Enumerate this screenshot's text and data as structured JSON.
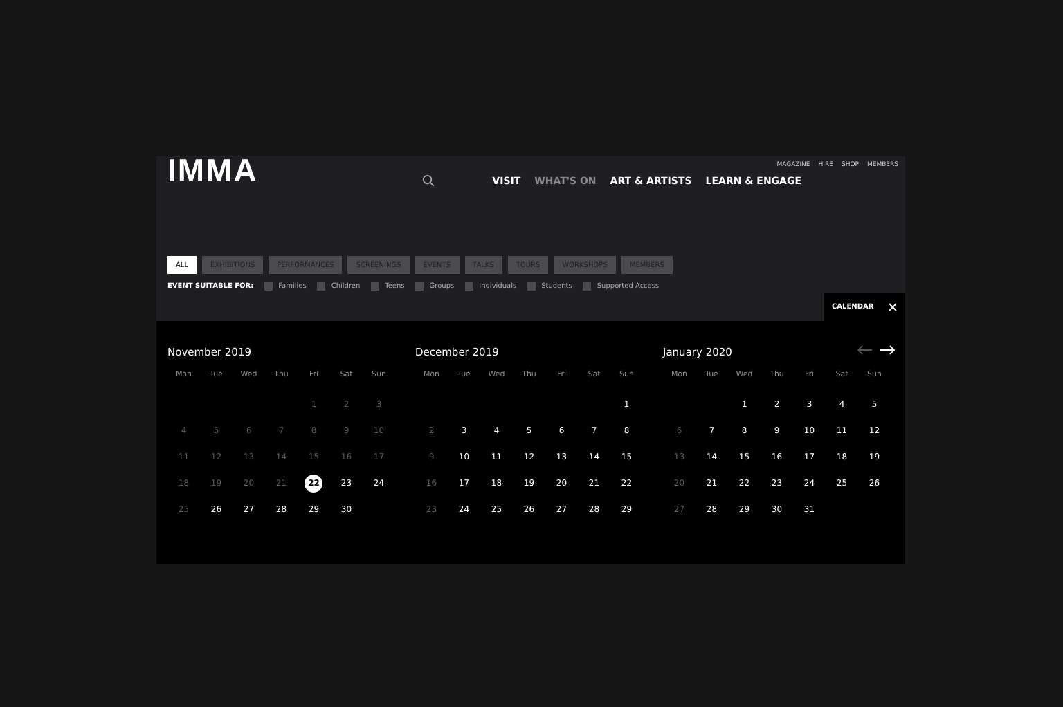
{
  "header": {
    "logo": "IMMA",
    "utility_links": [
      "MAGAZINE",
      "HIRE",
      "SHOP",
      "MEMBERS"
    ],
    "nav": [
      {
        "label": "VISIT",
        "selected": false
      },
      {
        "label": "WHAT'S ON",
        "selected": true
      },
      {
        "label": "ART & ARTISTS",
        "selected": false
      },
      {
        "label": "LEARN & ENGAGE",
        "selected": false
      }
    ]
  },
  "categories": [
    {
      "label": "ALL",
      "selected": true
    },
    {
      "label": "EXHIBITIONS",
      "selected": false
    },
    {
      "label": "PERFORMANCES",
      "selected": false
    },
    {
      "label": "SCREENINGS",
      "selected": false
    },
    {
      "label": "EVENTS",
      "selected": false
    },
    {
      "label": "TALKS",
      "selected": false
    },
    {
      "label": "TOURS",
      "selected": false
    },
    {
      "label": "WORKSHOPS",
      "selected": false
    },
    {
      "label": "MEMBERS",
      "selected": false
    }
  ],
  "audience": {
    "label": "EVENT SUITABLE FOR:",
    "options": [
      {
        "label": "Families",
        "checked": false
      },
      {
        "label": "Children",
        "checked": false
      },
      {
        "label": "Teens",
        "checked": false
      },
      {
        "label": "Groups",
        "checked": false
      },
      {
        "label": "Individuals",
        "checked": false
      },
      {
        "label": "Students",
        "checked": false
      },
      {
        "label": "Supported Access",
        "checked": false
      }
    ]
  },
  "calendar_tab": {
    "label": "CALENDAR"
  },
  "calendar": {
    "prev_disabled": true,
    "next_disabled": false,
    "months": [
      {
        "title": "November 2019",
        "weekdays": [
          "Mon",
          "Tue",
          "Wed",
          "Thu",
          "Fri",
          "Sat",
          "Sun"
        ],
        "weeks": [
          {
            "starts_mid_week": true,
            "days": [
              {
                "label": "1",
                "muted": true,
                "selected": false
              },
              {
                "label": "2",
                "muted": true,
                "selected": false
              },
              {
                "label": "3",
                "muted": true,
                "selected": false
              }
            ]
          },
          {
            "starts_mid_week": false,
            "days": [
              {
                "label": "4",
                "muted": true,
                "selected": false
              },
              {
                "label": "5",
                "muted": true,
                "selected": false
              },
              {
                "label": "6",
                "muted": true,
                "selected": false
              },
              {
                "label": "7",
                "muted": true,
                "selected": false
              },
              {
                "label": "8",
                "muted": true,
                "selected": false
              },
              {
                "label": "9",
                "muted": true,
                "selected": false
              },
              {
                "label": "10",
                "muted": true,
                "selected": false
              }
            ]
          },
          {
            "starts_mid_week": false,
            "days": [
              {
                "label": "11",
                "muted": true,
                "selected": false
              },
              {
                "label": "12",
                "muted": true,
                "selected": false
              },
              {
                "label": "13",
                "muted": true,
                "selected": false
              },
              {
                "label": "14",
                "muted": true,
                "selected": false
              },
              {
                "label": "15",
                "muted": true,
                "selected": false
              },
              {
                "label": "16",
                "muted": true,
                "selected": false
              },
              {
                "label": "17",
                "muted": true,
                "selected": false
              }
            ]
          },
          {
            "starts_mid_week": false,
            "days": [
              {
                "label": "18",
                "muted": true,
                "selected": false
              },
              {
                "label": "19",
                "muted": true,
                "selected": false
              },
              {
                "label": "20",
                "muted": true,
                "selected": false
              },
              {
                "label": "21",
                "muted": true,
                "selected": false
              },
              {
                "label": "22",
                "muted": false,
                "selected": true
              },
              {
                "label": "23",
                "muted": false,
                "selected": false
              },
              {
                "label": "24",
                "muted": false,
                "selected": false
              }
            ]
          },
          {
            "starts_mid_week": false,
            "days": [
              {
                "label": "25",
                "muted": true,
                "selected": false
              },
              {
                "label": "26",
                "muted": false,
                "selected": false
              },
              {
                "label": "27",
                "muted": false,
                "selected": false
              },
              {
                "label": "28",
                "muted": false,
                "selected": false
              },
              {
                "label": "29",
                "muted": false,
                "selected": false
              },
              {
                "label": "30",
                "muted": false,
                "selected": false
              }
            ]
          }
        ]
      },
      {
        "title": "December 2019",
        "weekdays": [
          "Mon",
          "Tue",
          "Wed",
          "Thu",
          "Fri",
          "Sat",
          "Sun"
        ],
        "weeks": [
          {
            "starts_mid_week": true,
            "days": [
              {
                "label": "1",
                "muted": false,
                "selected": false
              }
            ]
          },
          {
            "starts_mid_week": false,
            "days": [
              {
                "label": "2",
                "muted": true,
                "selected": false
              },
              {
                "label": "3",
                "muted": false,
                "selected": false
              },
              {
                "label": "4",
                "muted": false,
                "selected": false
              },
              {
                "label": "5",
                "muted": false,
                "selected": false
              },
              {
                "label": "6",
                "muted": false,
                "selected": false
              },
              {
                "label": "7",
                "muted": false,
                "selected": false
              },
              {
                "label": "8",
                "muted": false,
                "selected": false
              }
            ]
          },
          {
            "starts_mid_week": false,
            "days": [
              {
                "label": "9",
                "muted": true,
                "selected": false
              },
              {
                "label": "10",
                "muted": false,
                "selected": false
              },
              {
                "label": "11",
                "muted": false,
                "selected": false
              },
              {
                "label": "12",
                "muted": false,
                "selected": false
              },
              {
                "label": "13",
                "muted": false,
                "selected": false
              },
              {
                "label": "14",
                "muted": false,
                "selected": false
              },
              {
                "label": "15",
                "muted": false,
                "selected": false
              }
            ]
          },
          {
            "starts_mid_week": false,
            "days": [
              {
                "label": "16",
                "muted": true,
                "selected": false
              },
              {
                "label": "17",
                "muted": false,
                "selected": false
              },
              {
                "label": "18",
                "muted": false,
                "selected": false
              },
              {
                "label": "19",
                "muted": false,
                "selected": false
              },
              {
                "label": "20",
                "muted": false,
                "selected": false
              },
              {
                "label": "21",
                "muted": false,
                "selected": false
              },
              {
                "label": "22",
                "muted": false,
                "selected": false
              }
            ]
          },
          {
            "starts_mid_week": false,
            "days": [
              {
                "label": "23",
                "muted": true,
                "selected": false
              },
              {
                "label": "24",
                "muted": false,
                "selected": false
              },
              {
                "label": "25",
                "muted": false,
                "selected": false
              },
              {
                "label": "26",
                "muted": false,
                "selected": false
              },
              {
                "label": "27",
                "muted": false,
                "selected": false
              },
              {
                "label": "28",
                "muted": false,
                "selected": false
              },
              {
                "label": "29",
                "muted": false,
                "selected": false
              }
            ]
          }
        ]
      },
      {
        "title": "January 2020",
        "weekdays": [
          "Mon",
          "Tue",
          "Wed",
          "Thu",
          "Fri",
          "Sat",
          "Sun"
        ],
        "weeks": [
          {
            "starts_mid_week": true,
            "days": [
              {
                "label": "1",
                "muted": false,
                "selected": false
              },
              {
                "label": "2",
                "muted": false,
                "selected": false
              },
              {
                "label": "3",
                "muted": false,
                "selected": false
              },
              {
                "label": "4",
                "muted": false,
                "selected": false
              },
              {
                "label": "5",
                "muted": false,
                "selected": false
              }
            ]
          },
          {
            "starts_mid_week": false,
            "days": [
              {
                "label": "6",
                "muted": true,
                "selected": false
              },
              {
                "label": "7",
                "muted": false,
                "selected": false
              },
              {
                "label": "8",
                "muted": false,
                "selected": false
              },
              {
                "label": "9",
                "muted": false,
                "selected": false
              },
              {
                "label": "10",
                "muted": false,
                "selected": false
              },
              {
                "label": "11",
                "muted": false,
                "selected": false
              },
              {
                "label": "12",
                "muted": false,
                "selected": false
              }
            ]
          },
          {
            "starts_mid_week": false,
            "days": [
              {
                "label": "13",
                "muted": true,
                "selected": false
              },
              {
                "label": "14",
                "muted": false,
                "selected": false
              },
              {
                "label": "15",
                "muted": false,
                "selected": false
              },
              {
                "label": "16",
                "muted": false,
                "selected": false
              },
              {
                "label": "17",
                "muted": false,
                "selected": false
              },
              {
                "label": "18",
                "muted": false,
                "selected": false
              },
              {
                "label": "19",
                "muted": false,
                "selected": false
              }
            ]
          },
          {
            "starts_mid_week": false,
            "days": [
              {
                "label": "20",
                "muted": true,
                "selected": false
              },
              {
                "label": "21",
                "muted": false,
                "selected": false
              },
              {
                "label": "22",
                "muted": false,
                "selected": false
              },
              {
                "label": "23",
                "muted": false,
                "selected": false
              },
              {
                "label": "24",
                "muted": false,
                "selected": false
              },
              {
                "label": "25",
                "muted": false,
                "selected": false
              },
              {
                "label": "26",
                "muted": false,
                "selected": false
              }
            ]
          },
          {
            "starts_mid_week": false,
            "days": [
              {
                "label": "27",
                "muted": true,
                "selected": false
              },
              {
                "label": "28",
                "muted": false,
                "selected": false
              },
              {
                "label": "29",
                "muted": false,
                "selected": false
              },
              {
                "label": "30",
                "muted": false,
                "selected": false
              },
              {
                "label": "31",
                "muted": false,
                "selected": false
              }
            ]
          }
        ]
      }
    ]
  }
}
